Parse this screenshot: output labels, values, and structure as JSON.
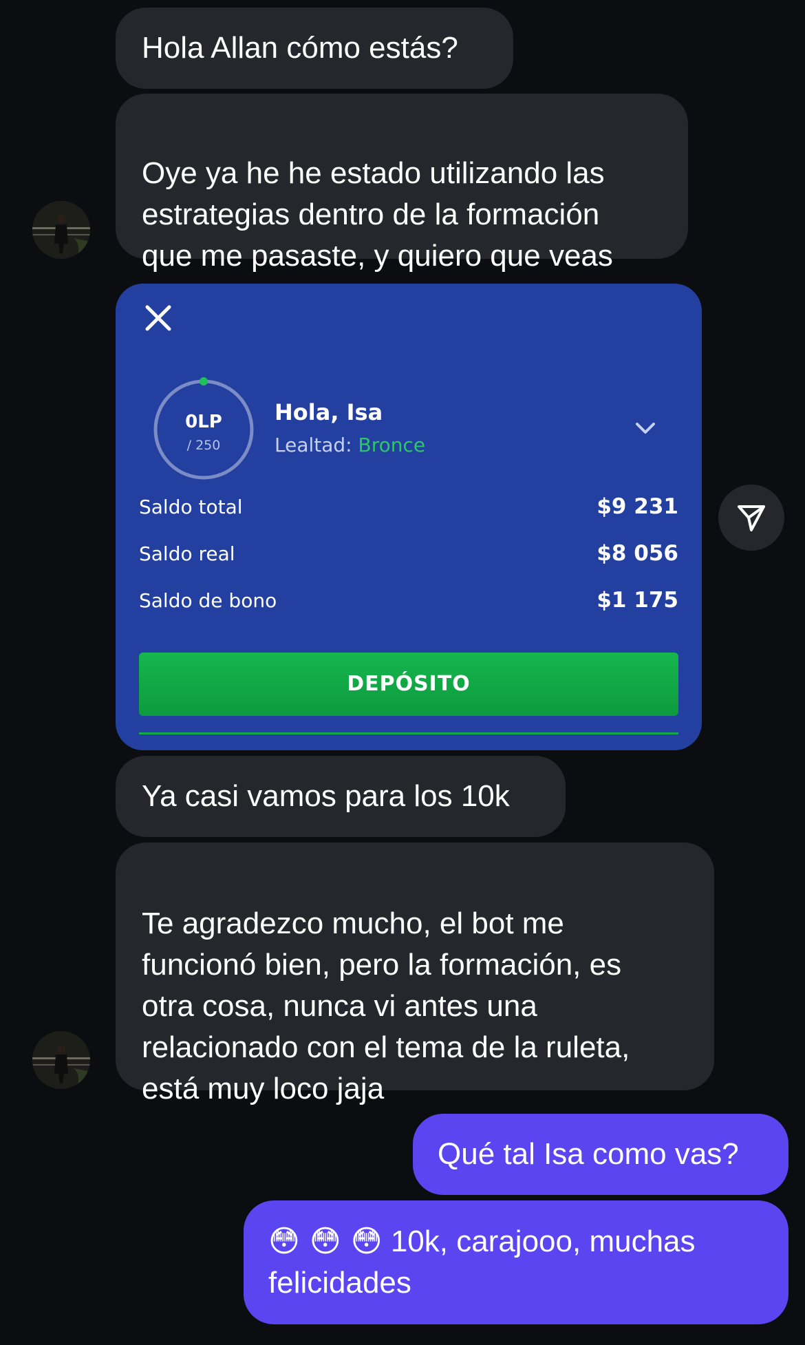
{
  "messages": {
    "m1": "Hola Allan cómo estás?",
    "m2": "Oye ya he he estado utilizando las\nestrategias dentro de la formación\nque me pasaste, y quiero que veas",
    "m3": "Ya casi vamos para los 10k",
    "m4": "Te agradezco mucho, el bot me\nfuncionó bien, pero la formación, es\notra cosa, nunca vi antes una\nrelacionado con el tema de la ruleta,\nestá muy loco jaja",
    "m5": "Qué tal Isa como vas?",
    "m6_emoji": "😳 😳 😳",
    "m6_text_line1": " 10k, carajooo, muchas",
    "m6_text_line2": "felicidades"
  },
  "card": {
    "loyalty_points": "0LP",
    "loyalty_max": "/ 250",
    "loyalty_progress": 0,
    "greeting": "Hola, Isa",
    "loyalty_label": "Lealtad: ",
    "loyalty_level": "Bronce",
    "balances": [
      {
        "label": "Saldo total",
        "value": "$9 231"
      },
      {
        "label": "Saldo real",
        "value": "$8 056"
      },
      {
        "label": "Saldo de bono",
        "value": "$1 175"
      }
    ],
    "deposit_label": "DEPÓSITO",
    "colors": {
      "background": "#2340a0",
      "accent_green": "#16b64e",
      "level_green": "#2fc56a"
    }
  },
  "icons": {
    "close": "close-icon",
    "chevron": "chevron-down-icon",
    "share": "send-icon",
    "avatar": "avatar"
  },
  "colors": {
    "background": "#0c0d11",
    "incoming_bubble": "#26272c",
    "outgoing_bubble": "#5b45f0"
  }
}
